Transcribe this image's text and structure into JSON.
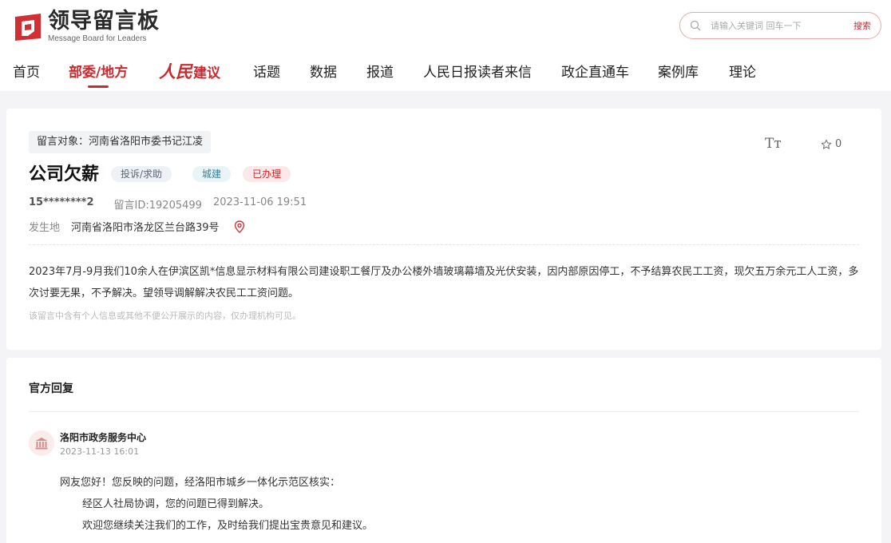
{
  "header": {
    "logo_title": "领导留言板",
    "logo_subtitle": "Message Board for Leaders",
    "search": {
      "placeholder": "请输入关键词 回车一下",
      "button_label": "搜索"
    },
    "nav": [
      {
        "label": "首页"
      },
      {
        "label": "部委/地方",
        "active": true
      },
      {
        "label": "人民建议",
        "script_part": "人民",
        "plain_part": "建议"
      },
      {
        "label": "话题"
      },
      {
        "label": "数据"
      },
      {
        "label": "报道"
      },
      {
        "label": "人民日报读者来信"
      },
      {
        "label": "政企直通车"
      },
      {
        "label": "案例库"
      },
      {
        "label": "理论"
      }
    ]
  },
  "message": {
    "target": "留言对象：河南省洛阳市委书记江凌",
    "title": "公司欠薪",
    "badges": {
      "type": "投诉/求助",
      "domain": "城建",
      "status": "已办理"
    },
    "font_toggle": "Tт",
    "star_count": "0",
    "user": "15********2",
    "message_id": "留言ID:19205499",
    "datetime": "2023-11-06 19:51",
    "location_label": "发生地",
    "location": "河南省洛阳市洛龙区兰台路39号",
    "content": "2023年7月-9月我们10余人在伊滨区凯*信息显示材料有限公司建设职工餐厅及办公楼外墙玻璃幕墙及光伏安装，因内部原因停工，不予结算农民工工资，现欠五万余元工人工资，多次讨要无果，不予解决。望领导调解解决农民工工资问题。",
    "notice": "该留言中含有个人信息或其他不便公开展示的内容，仅办理机构可见。"
  },
  "reply": {
    "section_title": "官方回复",
    "org_name": "洛阳市政务服务中心",
    "time": "2023-11-13 16:01",
    "greeting": "网友您好！您反映的问题，经洛阳市城乡一体化示范区核实：",
    "line_1": "经区人社局协调，您的问题已得到解决。",
    "line_2": "欢迎您继续关注我们的工作，及时给我们提出宝贵意见和建议。"
  },
  "colors": {
    "brand_red": "#c92a2f",
    "page_bg": "#f4f4f6"
  },
  "icons": [
    "logo-mark-icon",
    "search-icon",
    "star-icon",
    "location-pin-icon",
    "government-building-icon"
  ]
}
